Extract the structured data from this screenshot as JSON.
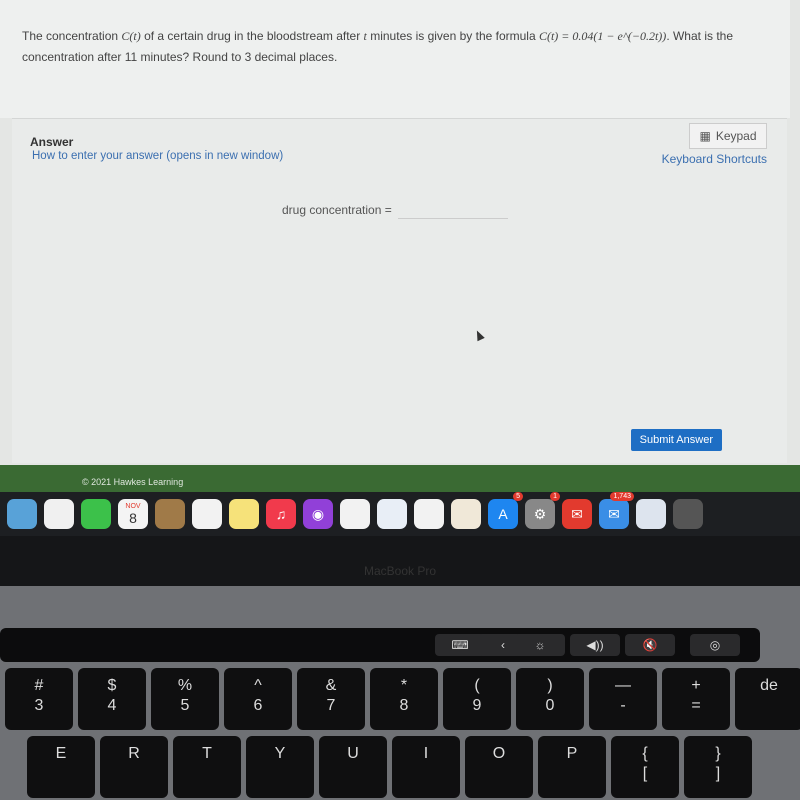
{
  "question": {
    "text_before": "The concentration ",
    "c_t": "C(t)",
    "text_mid": " of a certain drug in the bloodstream after ",
    "t": "t",
    "text_mid2": " minutes is given by the formula ",
    "formula": "C(t) = 0.04(1 − e^(−0.2t))",
    "text_after": ". What is the concentration after 11 minutes? Round to 3 decimal places."
  },
  "answer": {
    "title": "Answer",
    "how_link": "How to enter your answer (opens in new window)",
    "keypad_label": "Keypad",
    "shortcuts_label": "Keyboard Shortcuts",
    "field_label": "drug concentration =",
    "field_value": "",
    "submit_label": "Submit Answer"
  },
  "footer": {
    "copyright": "© 2021 Hawkes Learning"
  },
  "dock": {
    "apps": [
      {
        "name": "maps",
        "color": "#58a2d8"
      },
      {
        "name": "photos",
        "color": "#f0f0f0"
      },
      {
        "name": "facetime",
        "color": "#3cc14a"
      },
      {
        "name": "calendar",
        "color": "#f4f4f4",
        "month": "NOV",
        "day": "8"
      },
      {
        "name": "contacts",
        "color": "#a07a48"
      },
      {
        "name": "reminders",
        "color": "#f2f2f2"
      },
      {
        "name": "notes",
        "color": "#f6e27a"
      },
      {
        "name": "music",
        "color": "#f13a4c",
        "glyph": "♫"
      },
      {
        "name": "podcasts",
        "color": "#9140d8",
        "glyph": "◉"
      },
      {
        "name": "news",
        "color": "#f2f2f2"
      },
      {
        "name": "keynote",
        "color": "#e8eef6"
      },
      {
        "name": "numbers",
        "color": "#f2f2f2"
      },
      {
        "name": "pages",
        "color": "#f0e8d8"
      },
      {
        "name": "app-store",
        "color": "#1e86f0",
        "glyph": "A",
        "badge": "5"
      },
      {
        "name": "system-preferences",
        "color": "#888",
        "glyph": "⚙",
        "badge": "1"
      },
      {
        "name": "mail-app",
        "color": "#e23a2e",
        "glyph": "✉"
      },
      {
        "name": "mail",
        "color": "#3a8ee6",
        "glyph": "✉",
        "badge": "1,743"
      },
      {
        "name": "preview",
        "color": "#dde4ee"
      },
      {
        "name": "trash",
        "color": "#555"
      }
    ]
  },
  "bezel": {
    "label": "MacBook Pro"
  },
  "touchbar": {
    "items": [
      "⌨",
      "‹",
      "☼",
      "◀))",
      "🔇",
      "◎"
    ]
  },
  "keyboard": {
    "row1": [
      {
        "top": "#",
        "bottom": "3"
      },
      {
        "top": "$",
        "bottom": "4"
      },
      {
        "top": "%",
        "bottom": "5"
      },
      {
        "top": "^",
        "bottom": "6"
      },
      {
        "top": "&",
        "bottom": "7"
      },
      {
        "top": "*",
        "bottom": "8"
      },
      {
        "top": "(",
        "bottom": "9"
      },
      {
        "top": ")",
        "bottom": "0"
      },
      {
        "top": "—",
        "bottom": "-"
      },
      {
        "top": "+",
        "bottom": "="
      },
      {
        "top": "",
        "bottom": "de"
      }
    ],
    "row2": [
      {
        "top": "",
        "bottom": "E"
      },
      {
        "top": "",
        "bottom": "R"
      },
      {
        "top": "",
        "bottom": "T"
      },
      {
        "top": "",
        "bottom": "Y"
      },
      {
        "top": "",
        "bottom": "U"
      },
      {
        "top": "",
        "bottom": "I"
      },
      {
        "top": "",
        "bottom": "O"
      },
      {
        "top": "",
        "bottom": "P"
      },
      {
        "top": "{",
        "bottom": "["
      },
      {
        "top": "}",
        "bottom": "]"
      }
    ]
  }
}
